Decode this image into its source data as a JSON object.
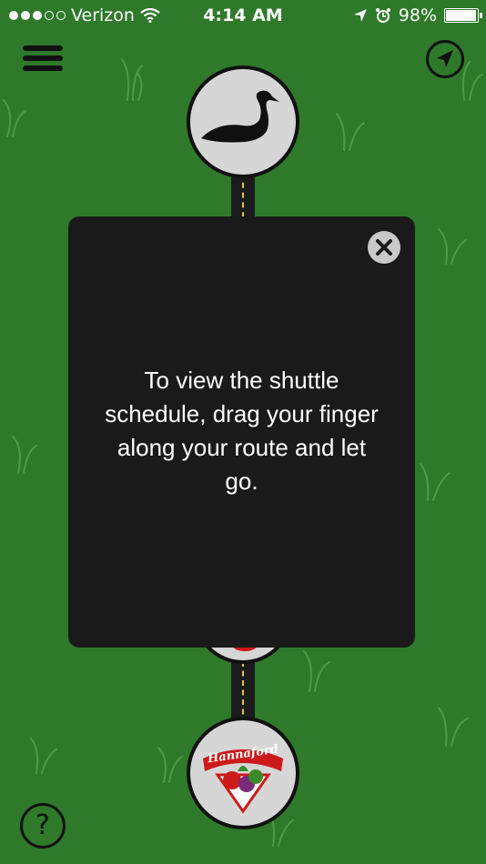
{
  "status_bar": {
    "carrier": "Verizon",
    "time": "4:14 AM",
    "battery_text": "98%",
    "battery_level": 0.98,
    "signal_filled": 3,
    "signal_total": 5
  },
  "stops": {
    "top_icon": "swan-icon",
    "bottom_logo_text": "Hannaford"
  },
  "dialog": {
    "message": "To view the shuttle schedule, drag your finger along your route and let go."
  },
  "help": {
    "label": "?"
  },
  "colors": {
    "background": "#2f7a2a",
    "dialog": "#1a1a1a",
    "stop_fill": "#d6d6d6",
    "road_line": "#e8c43a",
    "logo_red": "#cc1a1a"
  }
}
